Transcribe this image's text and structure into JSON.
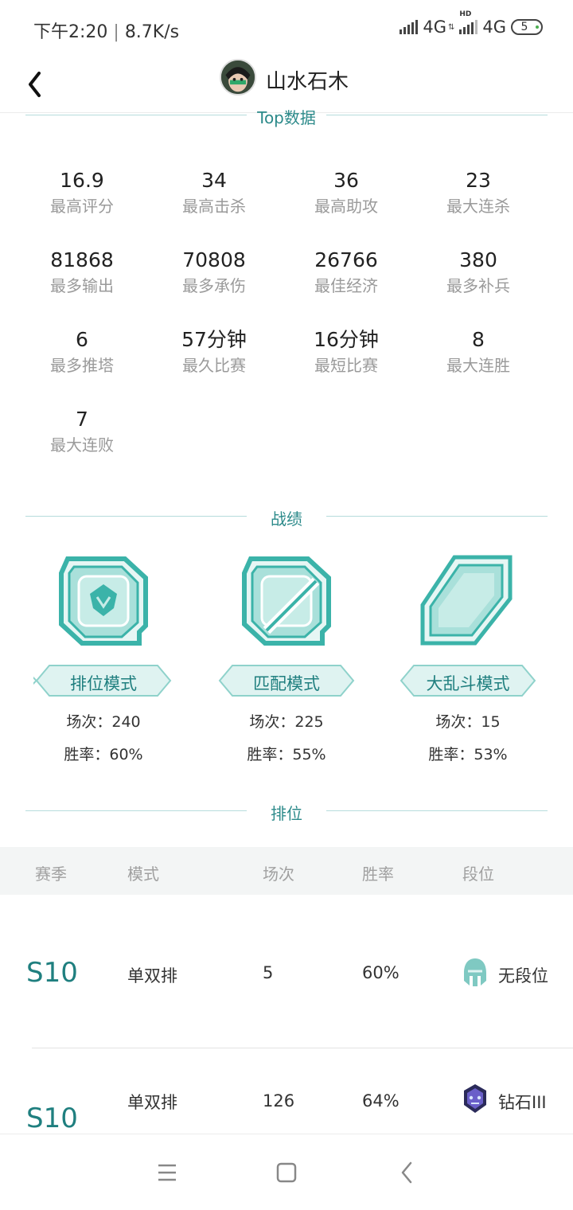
{
  "status": {
    "time": "下午2:20",
    "speed": "8.7K/s",
    "net1": "4G",
    "net2": "4G",
    "hd": "HD",
    "battery": "5"
  },
  "header": {
    "title": "山水石木"
  },
  "sections": {
    "top": "Top数据",
    "record": "战绩",
    "rank": "排位"
  },
  "top_stats": [
    {
      "value": "16.9",
      "label": "最高评分"
    },
    {
      "value": "34",
      "label": "最高击杀"
    },
    {
      "value": "36",
      "label": "最高助攻"
    },
    {
      "value": "23",
      "label": "最大连杀"
    },
    {
      "value": "81868",
      "label": "最多输出"
    },
    {
      "value": "70808",
      "label": "最多承伤"
    },
    {
      "value": "26766",
      "label": "最佳经济"
    },
    {
      "value": "380",
      "label": "最多补兵"
    },
    {
      "value": "6",
      "label": "最多推塔"
    },
    {
      "value": "57分钟",
      "label": "最久比赛"
    },
    {
      "value": "16分钟",
      "label": "最短比赛"
    },
    {
      "value": "8",
      "label": "最大连胜"
    },
    {
      "value": "7",
      "label": "最大连败"
    }
  ],
  "modes": [
    {
      "name": "排位模式",
      "count": "场次：240",
      "rate": "胜率：60%",
      "icon": "ranked-emblem-icon"
    },
    {
      "name": "匹配模式",
      "count": "场次：225",
      "rate": "胜率：55%",
      "icon": "match-emblem-icon"
    },
    {
      "name": "大乱斗模式",
      "count": "场次：15",
      "rate": "胜率：53%",
      "icon": "brawl-emblem-icon"
    }
  ],
  "rank_table": {
    "headers": [
      "赛季",
      "模式",
      "场次",
      "胜率",
      "段位"
    ],
    "rows": [
      {
        "season": "S10",
        "mode": "单双排",
        "games": "5",
        "rate": "60%",
        "tier": "无段位",
        "icon": "unranked-helmet-icon"
      },
      {
        "season": "S10",
        "mode": "单双排",
        "games": "126",
        "rate": "64%",
        "tier": "钻石III",
        "icon": "diamond-badge-icon"
      }
    ]
  },
  "colors": {
    "accent": "#2c8a8a",
    "teal_light": "#bfe8e4",
    "divider": "#b6dcdc"
  }
}
